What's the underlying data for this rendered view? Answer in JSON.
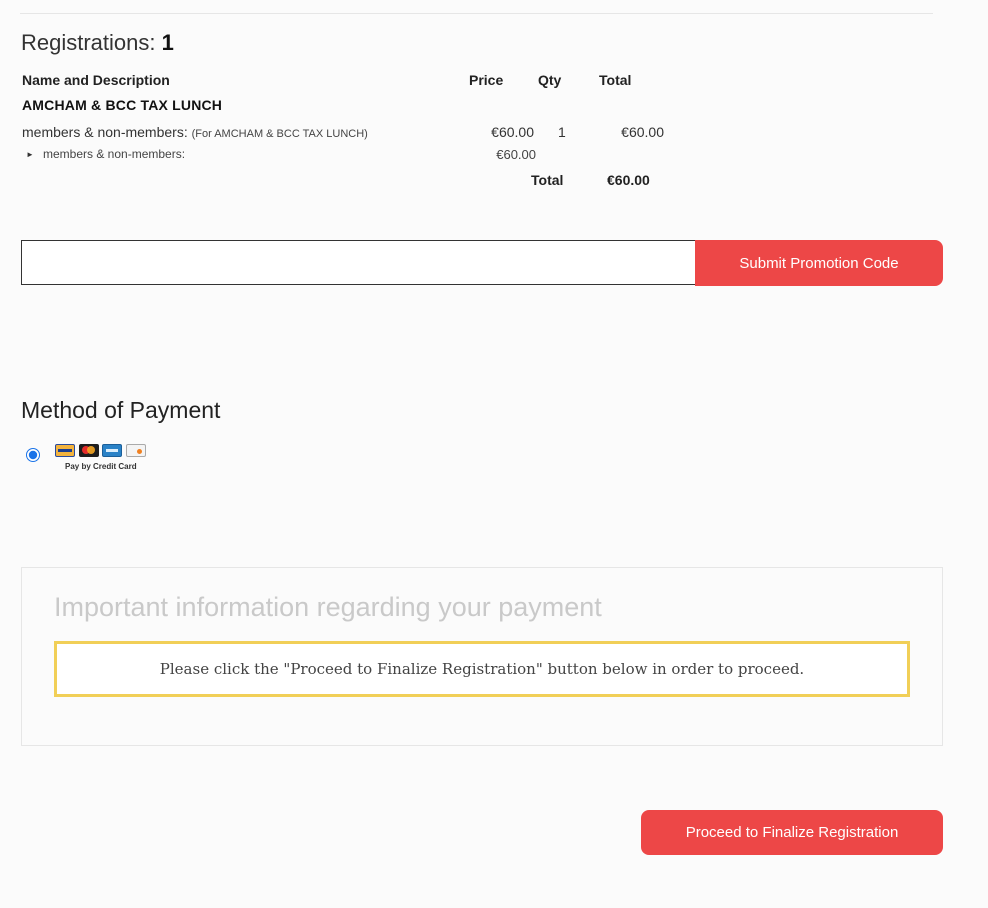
{
  "registrations": {
    "label": "Registrations:",
    "count": "1"
  },
  "table": {
    "headers": {
      "name": "Name and Description",
      "price": "Price",
      "qty": "Qty",
      "total": "Total"
    },
    "event_title": "AMCHAM & BCC TAX LUNCH",
    "item": {
      "name": "members & non-members:",
      "note": "(For AMCHAM & BCC TAX LUNCH)",
      "price": "€60.00",
      "qty": "1",
      "total": "€60.00"
    },
    "sub_item": {
      "name": "members & non-members:",
      "price": "€60.00"
    },
    "grand_total": {
      "label": "Total",
      "value": "€60.00"
    }
  },
  "promo": {
    "input_value": "",
    "placeholder": "",
    "button_label": "Submit Promotion Code"
  },
  "payment": {
    "heading": "Method of Payment",
    "option": {
      "selected": true,
      "caption": "Pay by Credit Card",
      "icons": [
        "visa-card-icon",
        "mastercard-icon",
        "amex-card-icon",
        "discover-card-icon"
      ]
    }
  },
  "info": {
    "heading": "Important information regarding your payment",
    "notice": "Please click the \"Proceed to Finalize Registration\" button below in order to proceed."
  },
  "actions": {
    "proceed_label": "Proceed to Finalize Registration"
  },
  "colors": {
    "accent": "#ed4747",
    "notice_border": "#f1cf57",
    "muted_heading": "#c9c9c9"
  }
}
